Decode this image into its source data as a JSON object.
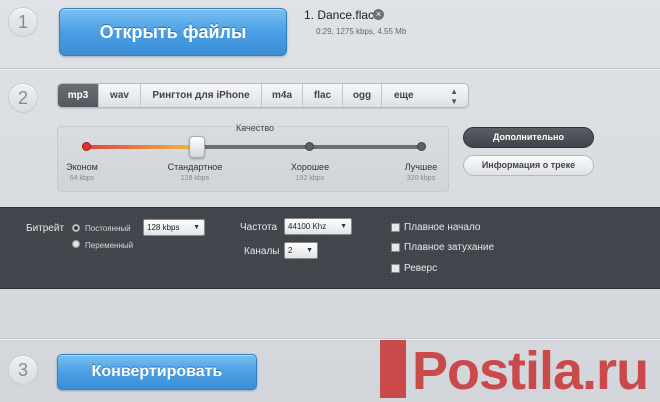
{
  "steps": [
    "1",
    "2",
    "3"
  ],
  "open_button": "Открыть файлы",
  "file": {
    "name": "1. Dance.flac",
    "meta": "0:29, 1275 kbps, 4.55 Mb",
    "remove_icon": "close-icon"
  },
  "tabs": [
    "mp3",
    "wav",
    "Рингтон для iPhone",
    "m4a",
    "flac",
    "ogg",
    "еще"
  ],
  "active_tab": "mp3",
  "quality": {
    "title": "Качество",
    "levels": [
      {
        "name": "Эконом",
        "bitrate": "64 kbps"
      },
      {
        "name": "Стандартное",
        "bitrate": "128 kbps"
      },
      {
        "name": "Хорошее",
        "bitrate": "192 kbps"
      },
      {
        "name": "Лучшее",
        "bitrate": "320 kbps"
      }
    ],
    "selected_index": 1,
    "fill_colors": [
      "#e04444",
      "#f0c040"
    ]
  },
  "side_buttons": {
    "advanced": "Дополнительно",
    "track_info": "Информация о треке"
  },
  "settings": {
    "bitrate_label": "Битрейт",
    "mode_constant": "Постоянный",
    "mode_variable": "Переменный",
    "bitrate_value": "128 kbps",
    "frequency_label": "Частота",
    "frequency_value": "44100 Khz",
    "channels_label": "Каналы",
    "channels_value": "2",
    "fade_in": "Плавное начало",
    "fade_out": "Плавное затухание",
    "reverse": "Реверс"
  },
  "convert_button": "Конвертировать",
  "watermark": "Postila.ru",
  "colors": {
    "accent_blue": "#4a9fe4",
    "panel_dark": "#3f444b",
    "watermark_red": "#c83737"
  }
}
